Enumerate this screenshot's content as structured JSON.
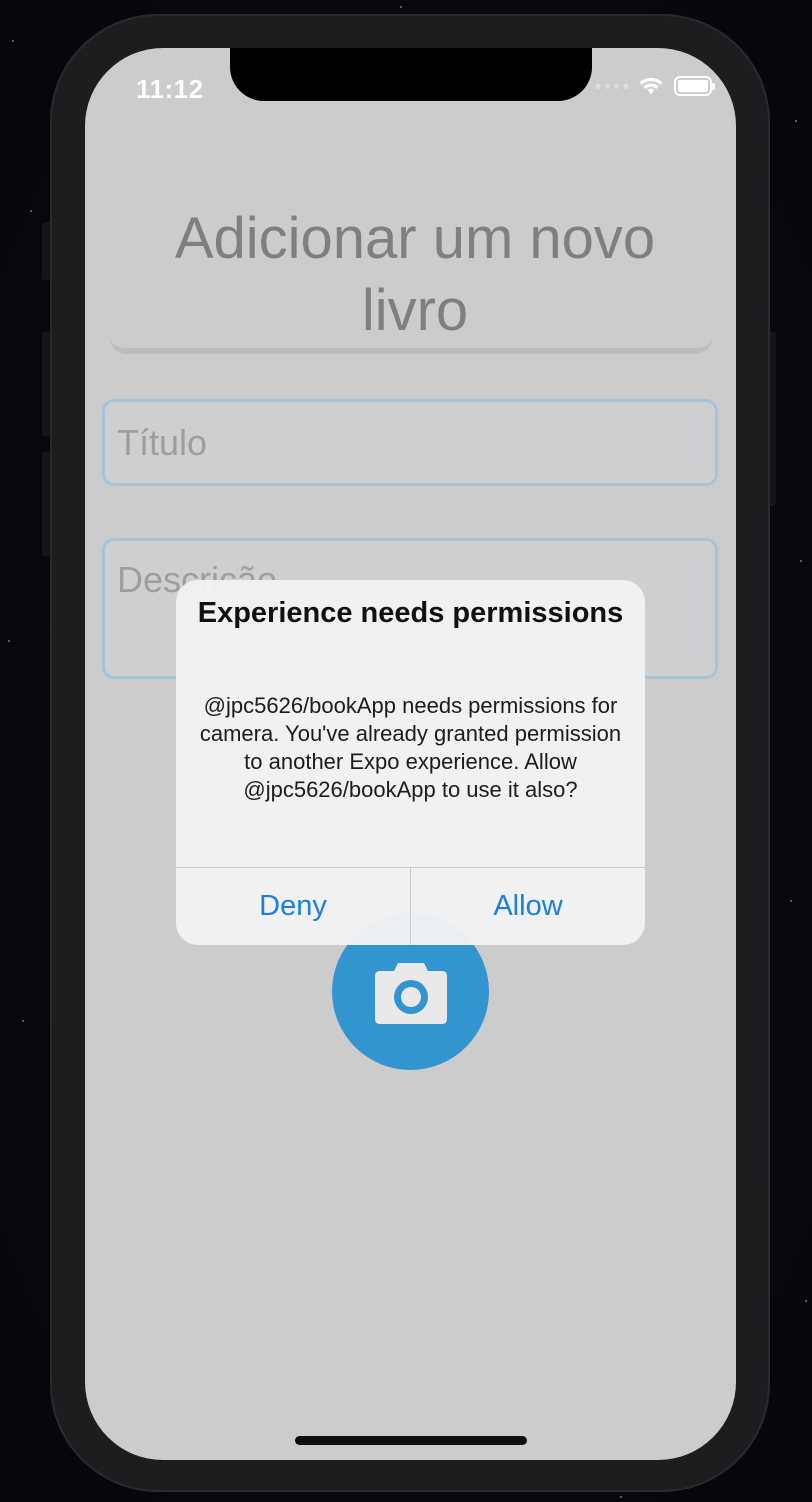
{
  "status_bar": {
    "time": "11:12"
  },
  "page": {
    "title": "Adicionar um novo livro"
  },
  "form": {
    "title_placeholder": "Título",
    "title_value": "",
    "description_placeholder": "Descrição",
    "description_value": ""
  },
  "alert": {
    "title": "Experience needs permissions",
    "message": "@jpc5626/bookApp needs permissions for camera. You've already granted permission to another Expo experience. Allow @jpc5626/bookApp to use it also?",
    "deny_label": "Deny",
    "allow_label": "Allow"
  },
  "icons": {
    "camera": "camera-icon",
    "wifi": "wifi-icon",
    "battery": "battery-icon"
  },
  "colors": {
    "accent": "#3295cf",
    "alert_button": "#1a7fe0",
    "background": "#cccccc"
  }
}
